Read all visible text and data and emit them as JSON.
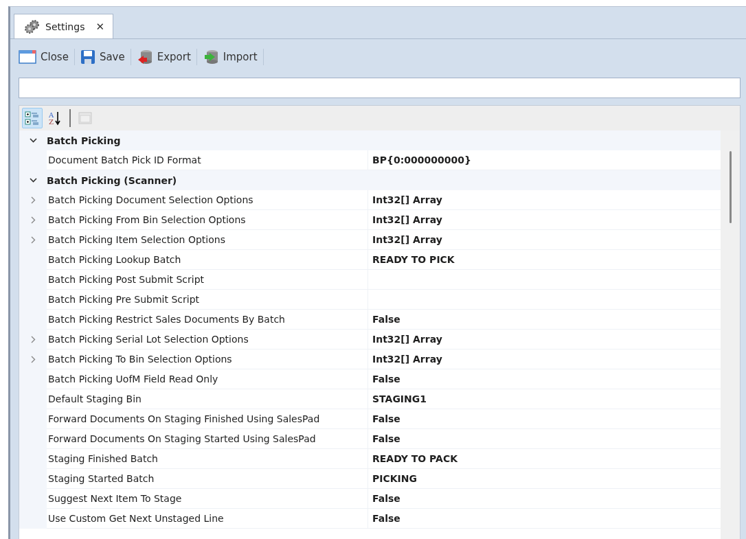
{
  "tabs": [
    {
      "label": "Settings",
      "selected": true,
      "close": "✕"
    }
  ],
  "toolbar": [
    {
      "label": "Close"
    },
    {
      "label": "Save"
    },
    {
      "label": "Export"
    },
    {
      "label": "Import"
    }
  ],
  "grid_toolbar": [
    {
      "kind": "categorized",
      "selected": true,
      "disabled": false
    },
    {
      "kind": "alphabetical",
      "selected": false,
      "disabled": false,
      "letters": [
        "A",
        "Z"
      ]
    },
    {
      "kind": "pages",
      "selected": false,
      "disabled": true
    }
  ],
  "categories": [
    {
      "name": "Batch Picking",
      "expanded": true,
      "properties": [
        {
          "name": "Document Batch Pick ID Format",
          "value": "BP{0:000000000}"
        }
      ]
    },
    {
      "name": "Batch Picking (Scanner)",
      "expanded": true,
      "properties": [
        {
          "name": "Batch Picking Document Selection Options",
          "value": "Int32[] Array",
          "expanded": false
        },
        {
          "name": "Batch Picking From Bin Selection Options",
          "value": "Int32[] Array",
          "expanded": false
        },
        {
          "name": "Batch Picking Item Selection Options",
          "value": "Int32[] Array",
          "expanded": false
        },
        {
          "name": "Batch Picking Lookup Batch",
          "value": "READY TO PICK"
        },
        {
          "name": "Batch Picking Post Submit Script"
        },
        {
          "name": "Batch Picking Pre Submit Script"
        },
        {
          "name": "Batch Picking Restrict Sales Documents By Batch",
          "value": "False"
        },
        {
          "name": "Batch Picking Serial Lot Selection Options",
          "value": "Int32[] Array",
          "expanded": false
        },
        {
          "name": "Batch Picking To Bin Selection Options",
          "value": "Int32[] Array",
          "expanded": false
        },
        {
          "name": "Batch Picking UofM Field Read Only",
          "value": "False"
        },
        {
          "name": "Default Staging Bin",
          "value": "STAGING1"
        },
        {
          "name": "Forward Documents On Staging Finished Using SalesPad",
          "value": "False"
        },
        {
          "name": "Forward Documents On Staging Started Using SalesPad",
          "value": "False"
        },
        {
          "name": "Staging Finished Batch",
          "value": "READY TO PACK"
        },
        {
          "name": "Staging Started Batch",
          "value": "PICKING"
        },
        {
          "name": "Suggest Next Item To Stage",
          "value": "False"
        },
        {
          "name": "Use Custom Get Next Unstaged Line",
          "value": "False"
        }
      ]
    }
  ]
}
